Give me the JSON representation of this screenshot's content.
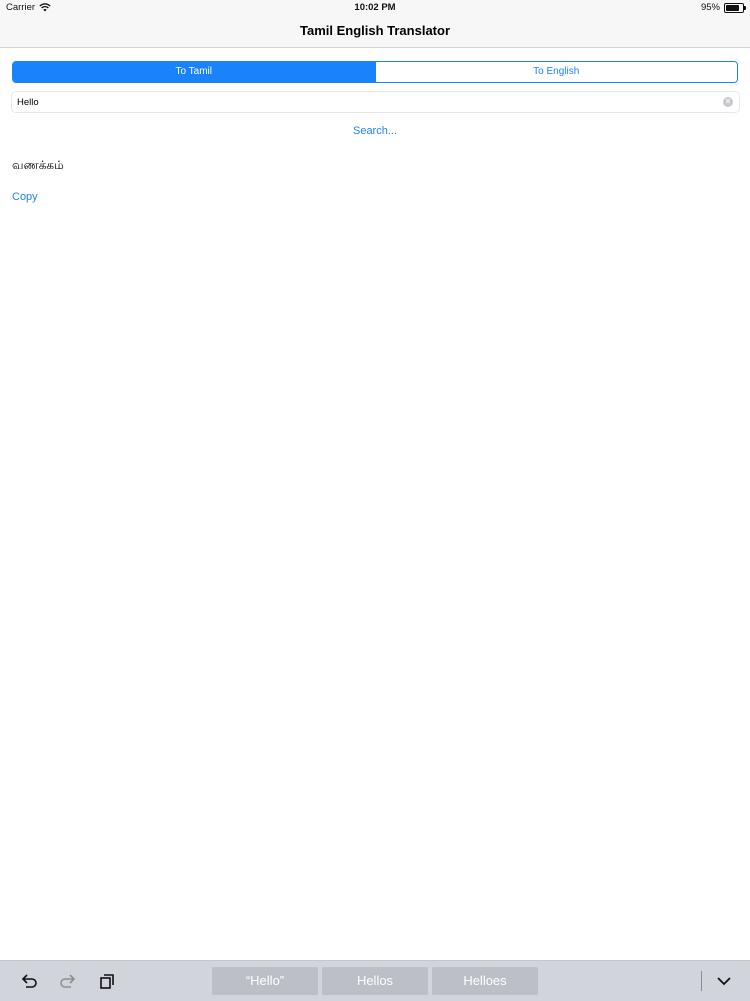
{
  "status_bar": {
    "carrier": "Carrier",
    "time": "10:02 PM",
    "battery": "95%",
    "battery_level": 0.95
  },
  "nav": {
    "title": "Tamil English Translator"
  },
  "segmented": {
    "options": [
      "To Tamil",
      "To English"
    ],
    "selected_index": 0
  },
  "search": {
    "value": "Hello",
    "clear_icon": "clear-icon"
  },
  "search_link": "Search...",
  "result_text": "வணக்கம்",
  "copy_label": "Copy",
  "keyboard_bar": {
    "suggestions": [
      "“Hello”",
      "Hellos",
      "Helloes"
    ],
    "icons": [
      "undo-icon",
      "redo-icon",
      "paste-icon",
      "dismiss-keyboard-icon"
    ]
  },
  "colors": {
    "accent": "#1a82fb",
    "bar_background": "#f7f7f7",
    "keyboard_background": "#d1d5db"
  }
}
